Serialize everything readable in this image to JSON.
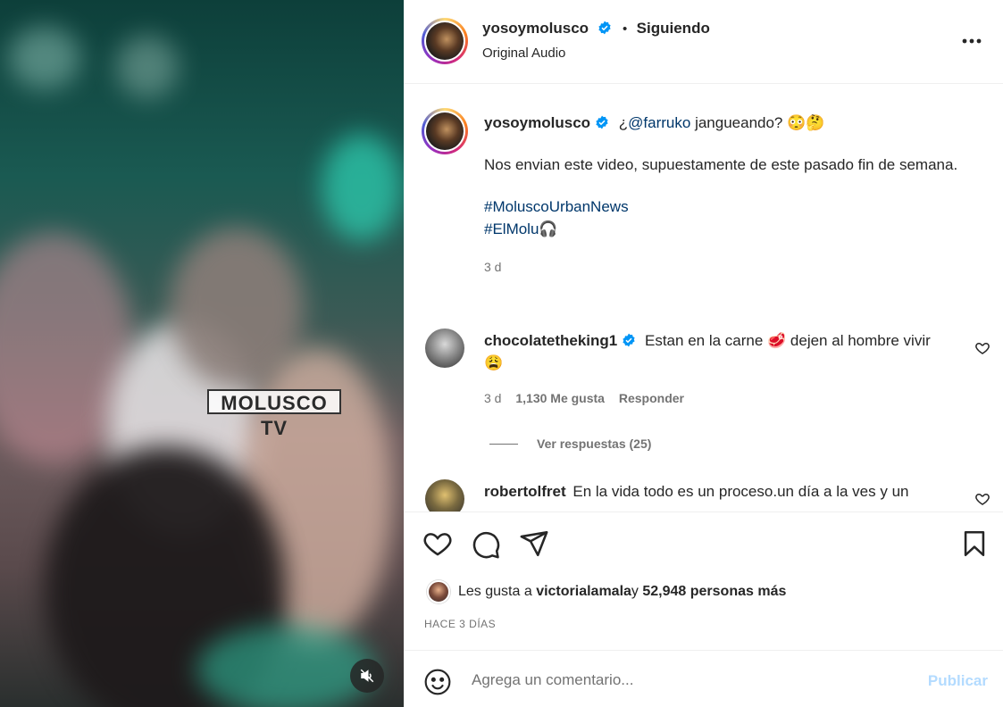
{
  "media": {
    "watermark": "MOLUSCO TV",
    "mute_icon": "speaker-muted-icon"
  },
  "header": {
    "username": "yosoymolusco",
    "dot": "•",
    "follow_status": "Siguiendo",
    "audio": "Original Audio",
    "more_icon": "more-options-icon"
  },
  "caption": {
    "username": "yosoymolusco",
    "prefix": "¿",
    "mention": "@farruko",
    "text1": " jangueando? 😳🤔",
    "text2": "Nos envian este video, supuestamente de este pasado fin de semana.",
    "hashtag1": "#MoluscoUrbanNews",
    "hashtag2": "#ElMolu🎧",
    "time": "3 d"
  },
  "comments": [
    {
      "username": "chocolatetheking1",
      "text": "Estan en la carne 🥩 dejen al hombre vivir 😩",
      "time": "3 d",
      "likes": "1,130 Me gusta",
      "reply": "Responder",
      "view_replies": "Ver respuestas (25)"
    },
    {
      "username": "robertolfret",
      "text": "En la vida todo es un proceso.un día a la ves y un"
    }
  ],
  "likes": {
    "prefix": "Les gusta a ",
    "user": "victorialamala",
    "middle": " y ",
    "count": "52,948 personas más"
  },
  "date_label": "HACE 3 DÍAS",
  "composer": {
    "placeholder": "Agrega un comentario...",
    "publish": "Publicar"
  },
  "colors": {
    "link": "#00376b",
    "verified": "#0095f6",
    "publish_disabled": "#b3dbff"
  }
}
